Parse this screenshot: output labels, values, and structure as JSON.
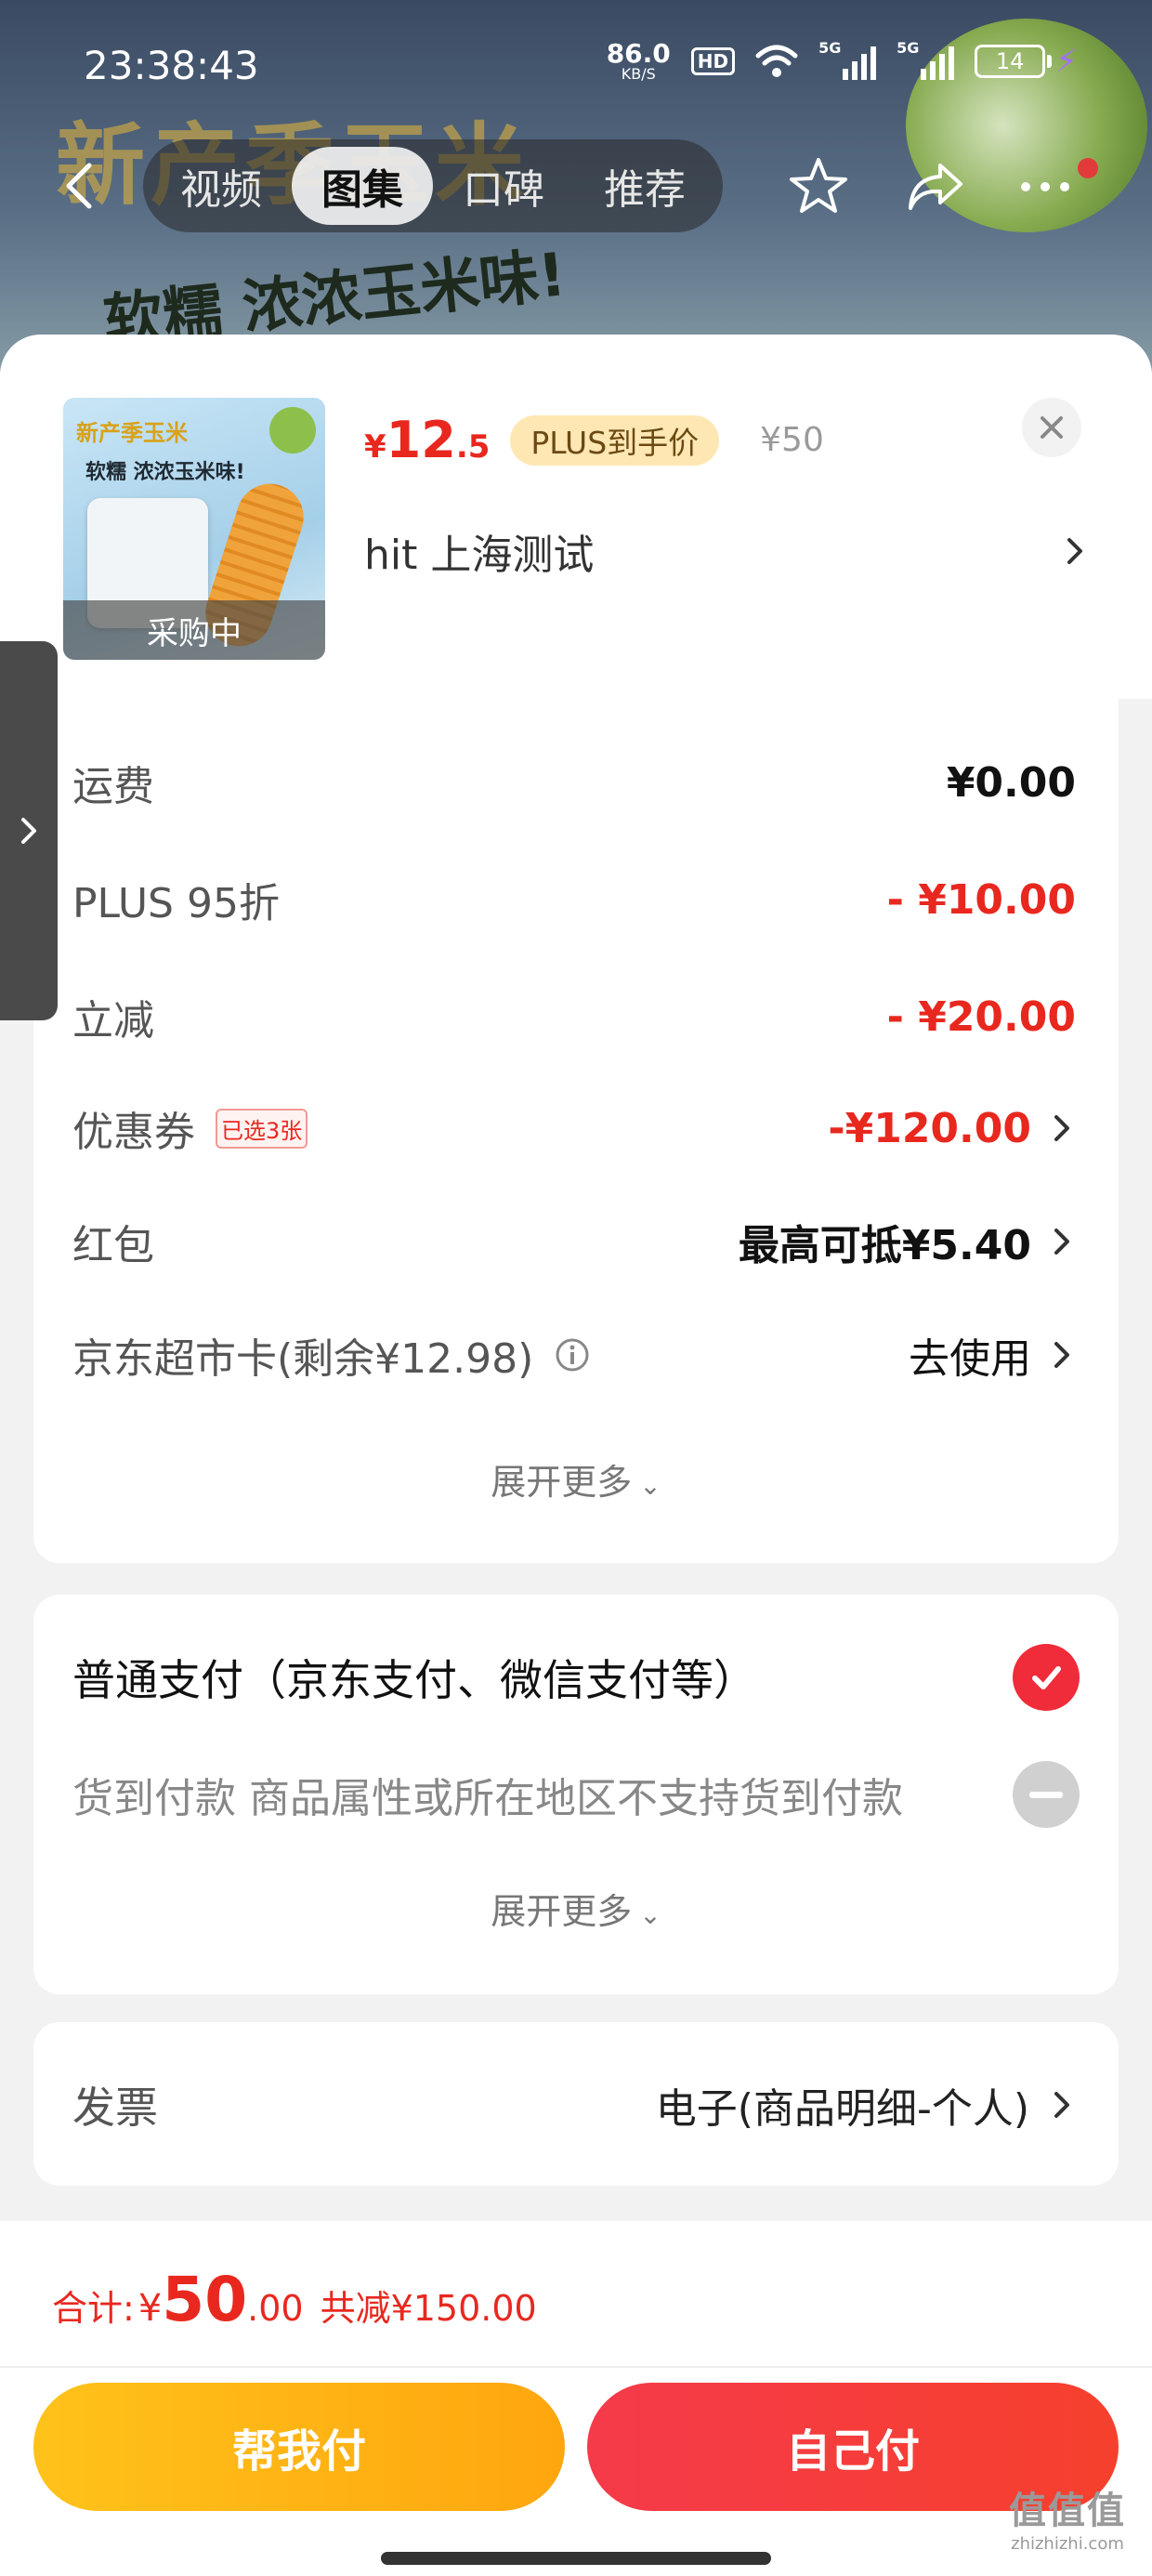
{
  "status_bar": {
    "time": "23:38:43",
    "net_speed": "86.0",
    "net_unit": "KB/S",
    "hd_badge": "HD",
    "sig1_label": "5G",
    "sig2_label": "5G",
    "battery": "14"
  },
  "background": {
    "headline": "新产季玉米",
    "slogan": "软糯 浓浓玉米味!"
  },
  "nav": {
    "tabs": [
      {
        "label": "视频"
      },
      {
        "label": "图集"
      },
      {
        "label": "口碑"
      },
      {
        "label": "推荐"
      }
    ],
    "active_tab": "图集"
  },
  "product": {
    "thumb_tag": "新产季玉米",
    "thumb_slogan": "软糯 浓浓玉米味!",
    "status": "采购中",
    "price_symbol": "¥",
    "price_int": "12",
    "price_dec": ".5",
    "plus_badge": "PLUS到手价",
    "original_price": "¥50",
    "address": "hit  上海测试"
  },
  "fees": {
    "rows": [
      {
        "label": "运费",
        "value": "¥0.00"
      },
      {
        "label": "PLUS 95折",
        "value": "- ¥10.00"
      },
      {
        "label": "立减",
        "value": "- ¥20.00"
      },
      {
        "label": "优惠券",
        "tag": "已选3张",
        "value": "-¥120.00"
      },
      {
        "label": "红包",
        "value": "最高可抵¥5.40"
      },
      {
        "label": "京东超市卡(剩余¥12.98)",
        "value": "去使用"
      }
    ],
    "expand_label": "展开更多"
  },
  "payment": {
    "options": [
      {
        "label": "普通支付（京东支付、微信支付等）",
        "selected": true
      },
      {
        "label": "货到付款 商品属性或所在地区不支持货到付款",
        "selected": false
      }
    ],
    "expand_label": "展开更多"
  },
  "invoice": {
    "label": "发票",
    "value": "电子(商品明细-个人)"
  },
  "summary": {
    "total_label": "合计:",
    "total_symbol": "¥",
    "total_int": "50",
    "total_dec": ".00",
    "savings": "共减¥150.00"
  },
  "buttons": {
    "help_pay": "帮我付",
    "self_pay": "自己付"
  },
  "watermark": {
    "brand": "值值值",
    "url": "zhizhizhi.com"
  },
  "colors": {
    "accent_red": "#e8281f",
    "help_button": "#ffb414",
    "self_button": "#f53a3c"
  }
}
